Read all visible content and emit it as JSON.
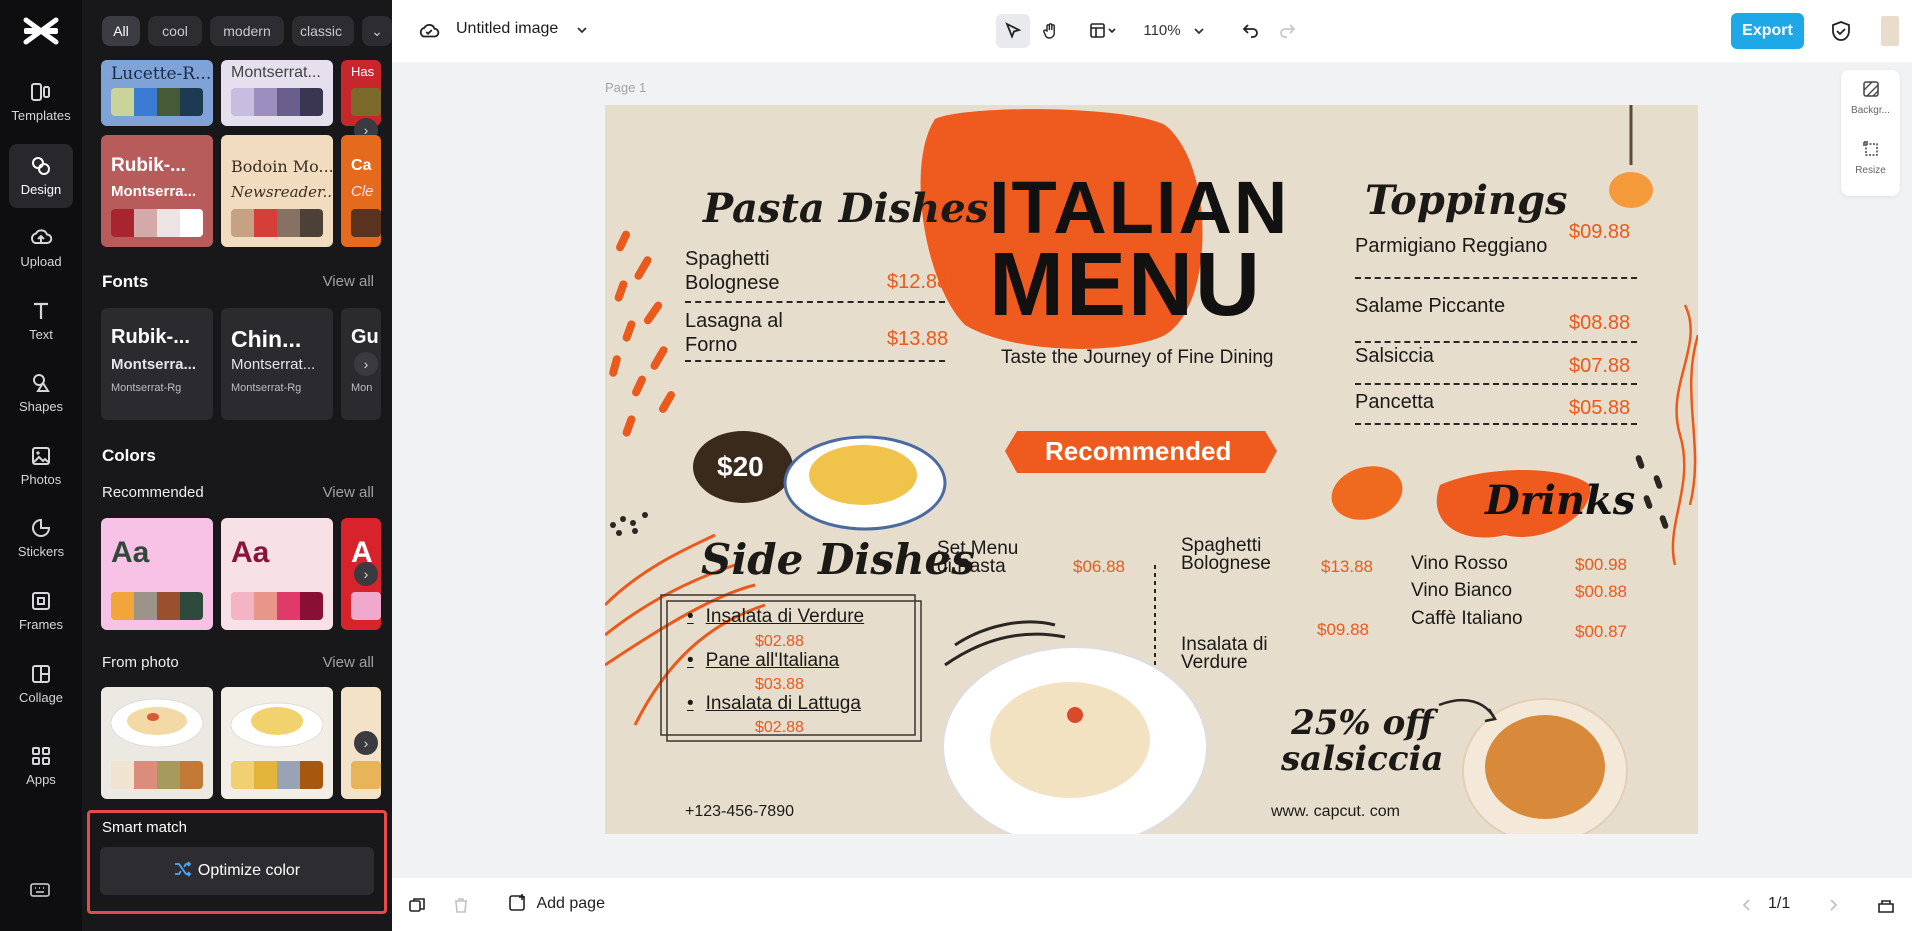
{
  "rail": {
    "items": [
      {
        "label": "Templates",
        "icon": "templates-icon"
      },
      {
        "label": "Design",
        "icon": "design-icon"
      },
      {
        "label": "Upload",
        "icon": "upload-icon"
      },
      {
        "label": "Text",
        "icon": "text-icon"
      },
      {
        "label": "Shapes",
        "icon": "shapes-icon"
      },
      {
        "label": "Photos",
        "icon": "photos-icon"
      },
      {
        "label": "Stickers",
        "icon": "stickers-icon"
      },
      {
        "label": "Frames",
        "icon": "frames-icon"
      },
      {
        "label": "Collage",
        "icon": "collage-icon"
      },
      {
        "label": "Apps",
        "icon": "apps-icon"
      }
    ]
  },
  "panel": {
    "filters": [
      "All",
      "cool",
      "modern",
      "classic"
    ],
    "themes_row1": [
      {
        "font1": "Lucette-R...",
        "font2": "",
        "bg": "#7fa3d6",
        "swatches": [
          "#c9d39a",
          "#3b7bd1",
          "#465a38",
          "#1c3a52"
        ]
      },
      {
        "font1": "Montserrat...",
        "font2": "",
        "bg": "#e6e0ee",
        "swatches": [
          "#c6bde0",
          "#9c8fbf",
          "#6a5f8c",
          "#3a3550"
        ]
      },
      {
        "font1": "Has",
        "font2": "",
        "bg": "#c7262c",
        "swatches": [
          "#7b6a2a"
        ]
      }
    ],
    "themes_row2": [
      {
        "font1": "Rubik-...",
        "font2": "Montserra...",
        "bg": "#b85b5b",
        "swatches": [
          "#a8242f",
          "#d3a9a9",
          "#ece4e4",
          "#ffffff"
        ]
      },
      {
        "font1": "Bodoin Mo...",
        "font2": "Newsreader...",
        "bg": "#f2dcc0",
        "swatches": [
          "#c7a183",
          "#d63e3a",
          "#857264",
          "#4c4037"
        ]
      },
      {
        "font1": "Ca",
        "font2": "Cle",
        "bg": "#e46a1e",
        "swatches": [
          "#5a3220"
        ]
      }
    ],
    "fonts_title": "Fonts",
    "view_all": "View all",
    "fonts": [
      {
        "f1": "Rubik-...",
        "f2": "Montserra...",
        "f3": "Montserrat-Rg"
      },
      {
        "f1": "Chin...",
        "f2": "Montserrat...",
        "f3": "Montserrat-Rg"
      },
      {
        "f1": "Gu",
        "f2": "",
        "f3": "Mon"
      }
    ],
    "colors_title": "Colors",
    "recommended_title": "Recommended",
    "recommended": [
      {
        "label": "Aa",
        "bg": "#f7c2e6",
        "fg": "#2f4a3a",
        "swatches": [
          "#f2a53a",
          "#9c9488",
          "#9a4f2f",
          "#2e4a3d"
        ]
      },
      {
        "label": "Aa",
        "bg": "#f7e1e6",
        "fg": "#8a1438",
        "swatches": [
          "#f4b4c4",
          "#e8958a",
          "#e03a6a",
          "#8a0f34"
        ]
      },
      {
        "label": "A",
        "bg": "#d9232c",
        "fg": "#ffffff",
        "swatches": [
          "#f0a8cc"
        ]
      }
    ],
    "from_photo_title": "From photo",
    "from_photo": [
      {
        "swatches": [
          "#f0e4d0",
          "#d98d7a",
          "#a59a5b",
          "#c07a35"
        ]
      },
      {
        "swatches": [
          "#f0d070",
          "#e3b43a",
          "#98a3b5",
          "#a8570e"
        ]
      },
      {
        "swatches": [
          "#e8b45a"
        ]
      }
    ],
    "smart_title": "Smart match",
    "optimize_label": "Optimize color"
  },
  "topbar": {
    "title": "Untitled image",
    "zoom": "110%",
    "export_label": "Export"
  },
  "canvas": {
    "page_label": "Page 1",
    "right_tools": [
      "Backgr...",
      "Resize"
    ]
  },
  "bottombar": {
    "add_page": "Add page",
    "page_count": "1/1"
  },
  "menu": {
    "title1": "ITALIAN",
    "title2": "MENU",
    "tagline": "Taste the Journey of Fine Dining",
    "pasta_title": "Pasta Dishes",
    "pasta": [
      {
        "name1": "Spaghetti",
        "name2": "Bolognese",
        "price": "$12.88"
      },
      {
        "name1": "Lasagna al",
        "name2": "Forno",
        "price": "$13.88"
      }
    ],
    "toppings_title": "Toppings",
    "toppings": [
      {
        "name": "Parmigiano Reggiano",
        "price": "$09.88"
      },
      {
        "name": "Salame Piccante",
        "price": "$08.88"
      },
      {
        "name": "Salsiccia",
        "price": "$07.88"
      },
      {
        "name": "Pancetta",
        "price": "$05.88"
      }
    ],
    "deal_price": "$20",
    "recommended": "Recommended",
    "side_title": "Side Dishes",
    "sides": [
      {
        "name": "Insalata di Verdure",
        "price": "$02.88"
      },
      {
        "name": "Pane all'Italiana",
        "price": "$03.88"
      },
      {
        "name": "Insalata di Lattuga",
        "price": "$02.88"
      }
    ],
    "set_menu1": "Set Menu",
    "set_menu2": "di Pasta",
    "set_menu_price": "$06.88",
    "rec_items": [
      {
        "name1": "Spaghetti",
        "name2": "Bolognese",
        "price": "$13.88"
      },
      {
        "name1": "Insalata di",
        "name2": "Verdure",
        "price": "$09.88"
      }
    ],
    "drinks_title": "Drinks",
    "drinks": [
      {
        "name": "Vino Rosso",
        "price": "$00.98"
      },
      {
        "name": "Vino Bianco",
        "price": "$00.88"
      },
      {
        "name": "Caffè Italiano",
        "price": "$00.87"
      }
    ],
    "promo1": "25% off",
    "promo2": "salsiccia",
    "phone": "+123-456-7890",
    "website": "www. capcut. com"
  }
}
